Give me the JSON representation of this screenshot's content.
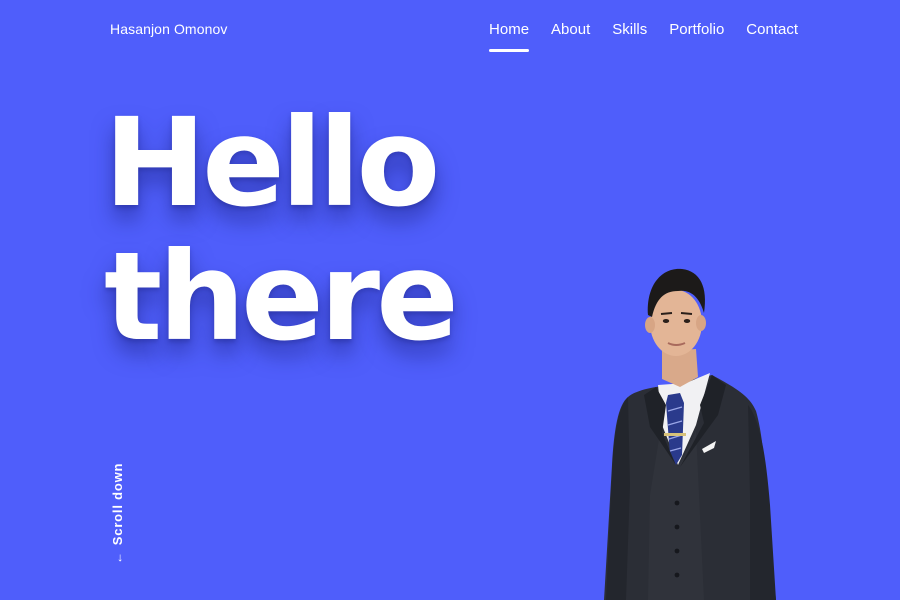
{
  "brand": {
    "name": "Hasanjon Omonov"
  },
  "nav": {
    "items": [
      {
        "label": "Home",
        "active": true
      },
      {
        "label": "About",
        "active": false
      },
      {
        "label": "Skills",
        "active": false
      },
      {
        "label": "Portfolio",
        "active": false
      },
      {
        "label": "Contact",
        "active": false
      }
    ]
  },
  "hero": {
    "line1": "Hello",
    "line2": "there"
  },
  "scroll": {
    "label": "Scroll down",
    "arrow_icon": "arrow-down-icon"
  },
  "portrait": {
    "icon": "person-portrait"
  },
  "colors": {
    "background": "#4f5efb",
    "text": "#ffffff",
    "suit": "#2b2e36",
    "tie": "#2a3a8c"
  }
}
